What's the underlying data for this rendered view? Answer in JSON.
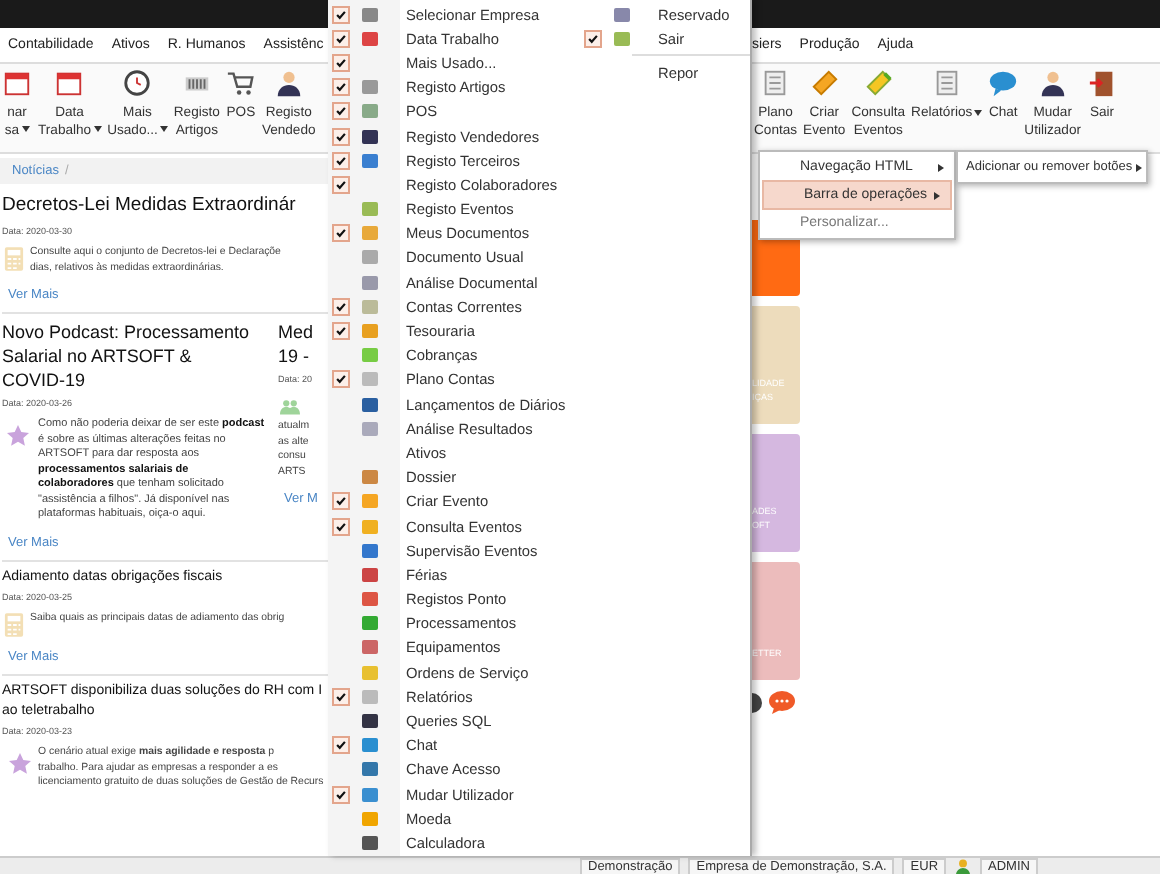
{
  "menubar": {
    "left": [
      "Contabilidade",
      "Ativos",
      "R. Humanos",
      "Assistênc"
    ],
    "right": [
      "siers",
      "Produção",
      "Ajuda"
    ]
  },
  "toolbar": {
    "left": [
      {
        "lines": [
          "nar",
          "sa"
        ],
        "dropdown": true
      },
      {
        "lines": [
          "Data",
          "Trabalho"
        ],
        "dropdown": true
      },
      {
        "lines": [
          "Mais",
          "Usado..."
        ],
        "dropdown": true
      },
      {
        "lines": [
          "Registo",
          "Artigos"
        ],
        "dropdown": false
      },
      {
        "lines": [
          "POS"
        ],
        "dropdown": false
      },
      {
        "lines": [
          "Registo",
          "Vendedo"
        ],
        "dropdown": false
      }
    ],
    "right": [
      {
        "lines": [
          "Plano",
          "Contas"
        ],
        "dropdown": false
      },
      {
        "lines": [
          "Criar",
          "Evento"
        ],
        "dropdown": false
      },
      {
        "lines": [
          "Consulta",
          "Eventos"
        ],
        "dropdown": false
      },
      {
        "lines": [
          "Relatórios"
        ],
        "dropdown": true
      },
      {
        "lines": [
          "Chat"
        ],
        "dropdown": false
      },
      {
        "lines": [
          "Mudar",
          "Utilizador"
        ],
        "dropdown": false
      },
      {
        "lines": [
          "Sair"
        ],
        "dropdown": false
      }
    ]
  },
  "breadcrumb": {
    "items": [
      "Notícias"
    ],
    "separator": "/"
  },
  "news": [
    {
      "kind": "legal",
      "featured": true,
      "title": [
        "Decretos-Lei Medidas Extraordinár"
      ],
      "date": "Data: 2020-03-30",
      "text": [
        "Consulte aqui o conjunto de Decretos-lei e Declaraçõe",
        "dias, relativos às medidas extraordinárias."
      ],
      "link": "Ver Mais"
    },
    {
      "cards": [
        {
          "kind": "news",
          "title": [
            "Novo Podcast: Processamento",
            "Salarial no ARTSOFT &",
            "COVID-19"
          ],
          "date": "Data: 2020-03-26",
          "paragraph": "Como não poderia deixar de ser este **podcast** é sobre as últimas alterações feitas no ARTSOFT para dar resposta aos **processamentos salariais de colaboradores** que tenham solicitado \"assistência a filhos\". Já disponível nas plataformas habituais, oiça-o aqui.",
          "link": "Ver Mais"
        },
        {
          "kind": "team",
          "title": [
            "Med",
            "19 -"
          ],
          "date": "Data: 20",
          "text": [
            "atualm",
            "as alte",
            "consu",
            "ARTS"
          ],
          "link": "Ver M"
        }
      ]
    },
    {
      "kind": "legal",
      "featured": false,
      "title": [
        "Adiamento datas obrigações fiscais"
      ],
      "date": "Data: 2020-03-25",
      "text": [
        "Saiba quais as principais datas de adiamento das obrig"
      ],
      "link": "Ver Mais"
    },
    {
      "kind": "news",
      "featured": false,
      "title": [
        "ARTSOFT disponibiliza duas soluções do RH com I",
        "ao teletrabalho"
      ],
      "date": "Data: 2020-03-23",
      "text": [
        "O cenário atual exige **mais agilidade e resposta** p",
        "trabalho. Para ajudar as empresas a responder a es",
        "licenciamento gratuito de duas soluções de Gestão de Recurs"
      ]
    }
  ],
  "dropdown": {
    "columns": [
      [
        {
          "label": "Selecionar Empresa",
          "checked": true,
          "has_icon": true
        },
        {
          "label": "Data Trabalho",
          "checked": true,
          "has_icon": true
        },
        {
          "label": "Mais Usado...",
          "checked": true,
          "has_icon": false
        },
        {
          "label": "Registo Artigos",
          "checked": true,
          "has_icon": true
        },
        {
          "label": "POS",
          "checked": true,
          "has_icon": true
        },
        {
          "label": "Registo Vendedores",
          "checked": true,
          "has_icon": true
        },
        {
          "label": "Registo Terceiros",
          "checked": true,
          "has_icon": true
        },
        {
          "label": "Registo Colaboradores",
          "checked": true,
          "has_icon": false
        },
        {
          "label": "Registo Eventos",
          "checked": false,
          "has_icon": true
        },
        {
          "label": "Meus Documentos",
          "checked": true,
          "has_icon": true
        },
        {
          "label": "Documento Usual",
          "checked": false,
          "has_icon": true
        },
        {
          "label": "Análise Documental",
          "checked": false,
          "has_icon": true
        },
        {
          "label": "Contas Correntes",
          "checked": true,
          "has_icon": true
        },
        {
          "label": "Tesouraria",
          "checked": true,
          "has_icon": true
        },
        {
          "label": "Cobranças",
          "checked": false,
          "has_icon": true
        },
        {
          "label": "Plano Contas",
          "checked": true,
          "has_icon": true
        },
        {
          "label": "Lançamentos de Diários",
          "checked": false,
          "has_icon": true
        },
        {
          "label": "Análise Resultados",
          "checked": false,
          "has_icon": true
        },
        {
          "label": "Ativos",
          "checked": false,
          "has_icon": false
        },
        {
          "label": "Dossier",
          "checked": false,
          "has_icon": true
        },
        {
          "label": "Criar Evento",
          "checked": true,
          "has_icon": true
        },
        {
          "label": "Consulta Eventos",
          "checked": true,
          "has_icon": true
        },
        {
          "label": "Supervisão Eventos",
          "checked": false,
          "has_icon": true
        },
        {
          "label": "Férias",
          "checked": false,
          "has_icon": true
        },
        {
          "label": "Registos Ponto",
          "checked": false,
          "has_icon": true
        },
        {
          "label": "Processamentos",
          "checked": false,
          "has_icon": true
        },
        {
          "label": "Equipamentos",
          "checked": false,
          "has_icon": true
        },
        {
          "label": "Ordens de Serviço",
          "checked": false,
          "has_icon": true
        },
        {
          "label": "Relatórios",
          "checked": true,
          "has_icon": true
        },
        {
          "label": "Queries SQL",
          "checked": false,
          "has_icon": true
        },
        {
          "label": "Chat",
          "checked": true,
          "has_icon": true
        },
        {
          "label": "Chave Acesso",
          "checked": false,
          "has_icon": true
        },
        {
          "label": "Mudar Utilizador",
          "checked": true,
          "has_icon": true
        },
        {
          "label": "Moeda",
          "checked": false,
          "has_icon": true
        },
        {
          "label": "Calculadora",
          "checked": false,
          "has_icon": true
        }
      ],
      [
        {
          "label": "Reservado",
          "checked": false,
          "has_icon": true
        },
        {
          "label": "Sair",
          "checked": true,
          "has_icon": true
        },
        {
          "kind": "separator"
        },
        {
          "label": "Repor",
          "checked": false,
          "has_icon": false
        }
      ]
    ]
  },
  "context_menu": {
    "items": [
      {
        "label": "Navegação HTML",
        "submenu": true,
        "selected": false,
        "disabled": false
      },
      {
        "label": "Barra de operações",
        "submenu": true,
        "selected": true,
        "disabled": false
      },
      {
        "label": "Personalizar...",
        "submenu": false,
        "selected": false,
        "disabled": true
      }
    ],
    "submenu": [
      {
        "label": "Adicionar ou remover botões",
        "submenu": true
      }
    ]
  },
  "tiles": [
    {
      "color": "#ff6a13"
    },
    {
      "color": "#eddcbc",
      "lines": [
        "LIDADE",
        "IÇAS"
      ]
    },
    {
      "color": "#d5b8e0",
      "lines": [
        "ADES",
        "OFT"
      ]
    },
    {
      "color": "#ecbcbc",
      "lines": [
        "ETTER"
      ]
    }
  ],
  "status_bar": [
    "Demonstração",
    "Empresa de Demonstração, S.A.",
    "EUR",
    "ADMIN"
  ]
}
